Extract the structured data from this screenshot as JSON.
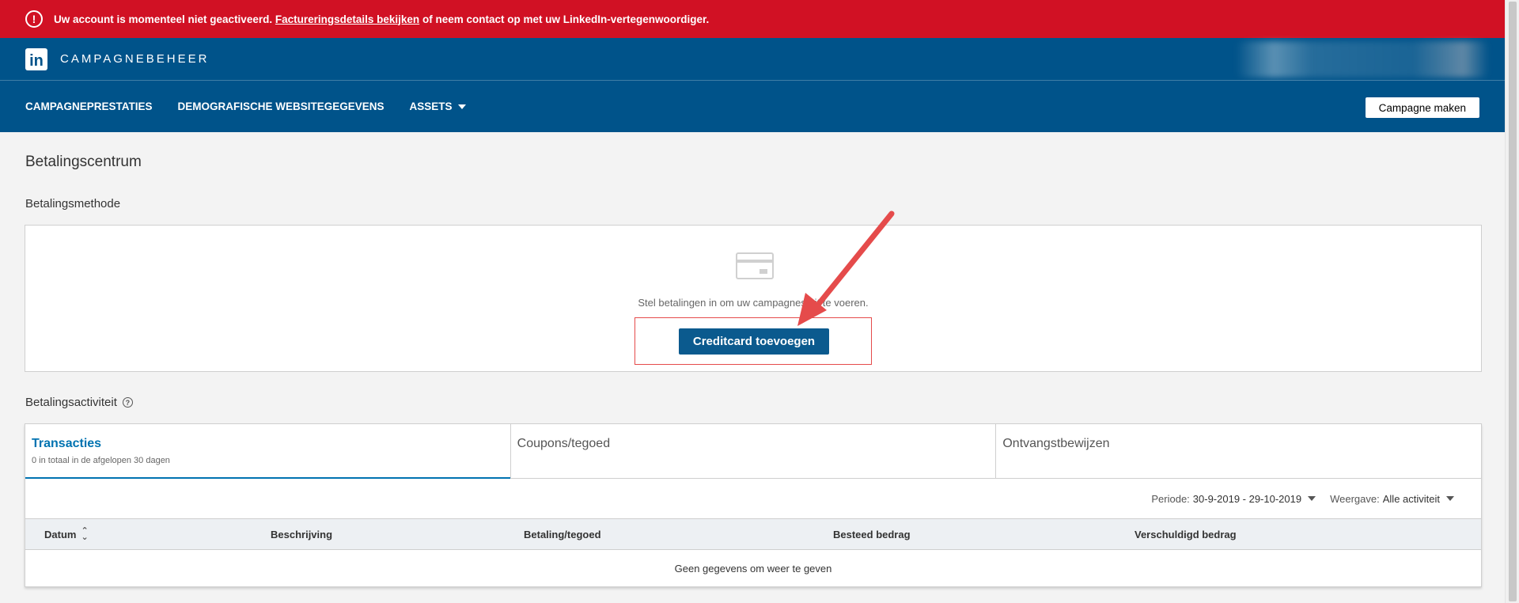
{
  "alert": {
    "icon": "exclamation-circle-icon",
    "text_before": "Uw account is momenteel niet geactiveerd.",
    "link": "Factureringsdetails bekijken",
    "text_after": "of neem contact op met uw LinkedIn-vertegenwoordiger.",
    "color": "#d11124"
  },
  "header": {
    "logo": "in",
    "brand": "CAMPAGNEBEHEER",
    "color": "#00538a"
  },
  "nav": {
    "items": [
      "CAMPAGNEPRESTATIES",
      "DEMOGRAFISCHE WEBSITEGEGEVENS",
      "ASSETS"
    ],
    "create_button": "Campagne maken"
  },
  "page": {
    "title": "Betalingscentrum"
  },
  "payment_method": {
    "title": "Betalingsmethode",
    "icon": "credit-card-icon",
    "message": "Stel betalingen in om uw campagnes uit te voeren.",
    "button": "Creditcard toevoegen",
    "button_color": "#0b5a8e"
  },
  "activity": {
    "title": "Betalingsactiviteit",
    "help_icon": "?",
    "tabs": [
      {
        "label": "Transacties",
        "sub": "0 in totaal in de afgelopen 30 dagen"
      },
      {
        "label": "Coupons/tegoed",
        "sub": ""
      },
      {
        "label": "Ontvangstbewijzen",
        "sub": ""
      }
    ],
    "period_label": "Periode:",
    "period_value": "30-9-2019 - 29-10-2019",
    "view_label": "Weergave:",
    "view_value": "Alle activiteit",
    "columns": [
      "Datum",
      "Beschrijving",
      "Betaling/tegoed",
      "Besteed bedrag",
      "Verschuldigd bedrag"
    ],
    "empty_text": "Geen gegevens om weer te geven"
  },
  "annotation": {
    "arrow_color": "#e54b4b"
  }
}
